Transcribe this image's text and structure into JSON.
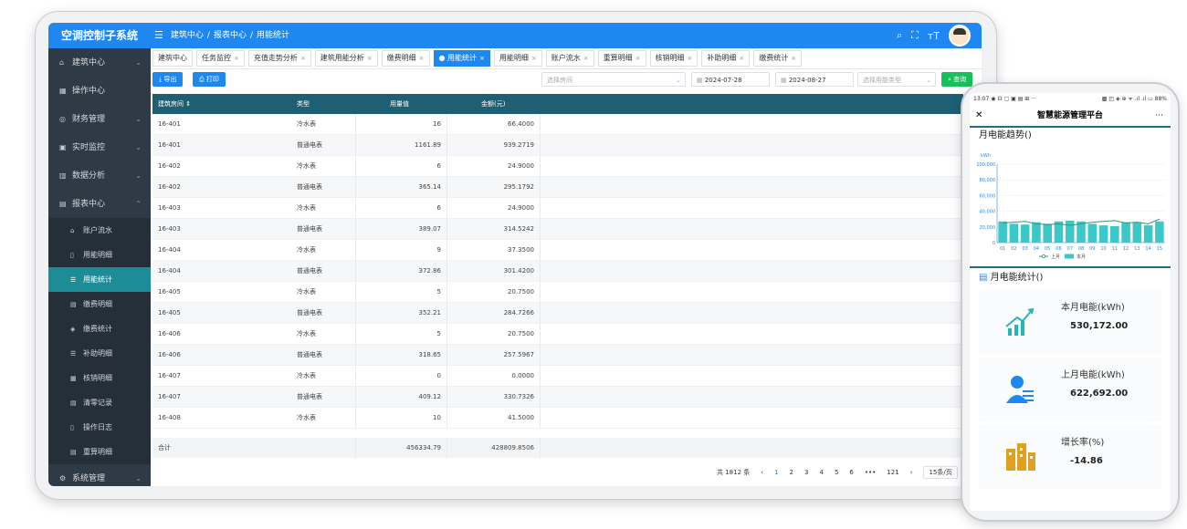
{
  "app": {
    "title": "空调控制子系统",
    "breadcrumb": [
      "建筑中心",
      "报表中心",
      "用能统计"
    ]
  },
  "sidebar": {
    "items": [
      {
        "label": "建筑中心",
        "icon": "home-icon",
        "arrow": "⌄"
      },
      {
        "label": "操作中心",
        "icon": "grid-icon",
        "arrow": ""
      },
      {
        "label": "财务管理",
        "icon": "finance-icon",
        "arrow": "⌄"
      },
      {
        "label": "实时监控",
        "icon": "monitor-icon",
        "arrow": "⌄"
      },
      {
        "label": "数据分析",
        "icon": "chart-icon",
        "arrow": "⌄"
      },
      {
        "label": "报表中心",
        "icon": "report-icon",
        "arrow": "⌃"
      }
    ],
    "sub_items": [
      "账户流水",
      "用能明细",
      "用能统计",
      "缴费明细",
      "缴费统计",
      "补助明细",
      "核销明细",
      "清零记录",
      "操作日志",
      "重算明细"
    ],
    "bottom": {
      "label": "系统管理",
      "arrow": "⌄"
    }
  },
  "tabs": [
    {
      "label": "建筑中心",
      "closable": false
    },
    {
      "label": "任务监控",
      "closable": true
    },
    {
      "label": "充值走势分析",
      "closable": true
    },
    {
      "label": "建筑用能分析",
      "closable": true
    },
    {
      "label": "缴费明细",
      "closable": true
    },
    {
      "label": "● 用能统计",
      "closable": true,
      "active": true
    },
    {
      "label": "用能明细",
      "closable": true
    },
    {
      "label": "账户流水",
      "closable": true
    },
    {
      "label": "重算明细",
      "closable": true
    },
    {
      "label": "核销明细",
      "closable": true
    },
    {
      "label": "补助明细",
      "closable": true
    },
    {
      "label": "缴费统计",
      "closable": true
    }
  ],
  "toolbar": {
    "export": "⤓ 导出",
    "print": "⎙ 打印",
    "room_placeholder": "选择房间",
    "date_start": "2024-07-28",
    "date_end": "2024-08-27",
    "type_placeholder": "选择用能类型",
    "query": "⌕ 查询"
  },
  "table": {
    "headers": [
      "建筑房间 ⇕",
      "类型",
      "用量值",
      "金额(元)"
    ],
    "rows": [
      [
        "16-401",
        "冷水表",
        "16",
        "66.4000"
      ],
      [
        "16-401",
        "普通电表",
        "1161.89",
        "939.2719"
      ],
      [
        "16-402",
        "冷水表",
        "6",
        "24.9000"
      ],
      [
        "16-402",
        "普通电表",
        "365.14",
        "295.1792"
      ],
      [
        "16-403",
        "冷水表",
        "6",
        "24.9000"
      ],
      [
        "16-403",
        "普通电表",
        "389.07",
        "314.5242"
      ],
      [
        "16-404",
        "冷水表",
        "9",
        "37.3500"
      ],
      [
        "16-404",
        "普通电表",
        "372.86",
        "301.4200"
      ],
      [
        "16-405",
        "冷水表",
        "5",
        "20.7500"
      ],
      [
        "16-405",
        "普通电表",
        "352.21",
        "284.7266"
      ],
      [
        "16-406",
        "冷水表",
        "5",
        "20.7500"
      ],
      [
        "16-406",
        "普通电表",
        "318.65",
        "257.5967"
      ],
      [
        "16-407",
        "冷水表",
        "0",
        "0.0000"
      ],
      [
        "16-407",
        "普通电表",
        "409.12",
        "330.7326"
      ],
      [
        "16-408",
        "冷水表",
        "10",
        "41.5000"
      ]
    ],
    "summary": {
      "label": "合计",
      "usage": "456334.79",
      "amount": "428809.8506"
    }
  },
  "pagination": {
    "total": "共 1812 条",
    "prev": "‹",
    "pages": [
      "1",
      "2",
      "3",
      "4",
      "5",
      "6",
      "•••",
      "121"
    ],
    "next": "›",
    "size": "15条/页"
  },
  "phone": {
    "status_left": "13:07 ◉ ☊ ▢ ▣ ▤ ⊞ ···",
    "status_right": "▩ ◰ ◈ ⊕ ᯤ .ıl .ıl ▭ 88%",
    "title": "智慧能源管理平台",
    "trend_title": "月电能趋势()",
    "stats_title": "月电能统计()",
    "stats": [
      {
        "label": "本月电能(kWh)",
        "value": "530,172.00",
        "icon": "rising-chart-icon",
        "color": "#27b5b7"
      },
      {
        "label": "上月电能(kWh)",
        "value": "622,692.00",
        "icon": "user-stats-icon",
        "color": "#1e88f0"
      },
      {
        "label": "增长率(%)",
        "value": "-14.86",
        "icon": "building-icon",
        "color": "#e0a020"
      }
    ]
  },
  "chart_data": {
    "type": "bar",
    "ylabel": "kWh",
    "ylim": [
      0,
      100000
    ],
    "yticks": [
      "100,000",
      "80,000",
      "60,000",
      "40,000",
      "20,000",
      "0"
    ],
    "categories": [
      "01",
      "02",
      "03",
      "04",
      "05",
      "06",
      "07",
      "08",
      "09",
      "10",
      "11",
      "12",
      "13",
      "14",
      "15"
    ],
    "series": [
      {
        "name": "本月",
        "type": "bar",
        "color": "#3cc7c9",
        "values": [
          27000,
          24000,
          23000,
          26000,
          24000,
          27000,
          28000,
          27000,
          24000,
          22000,
          21000,
          26000,
          26000,
          22000,
          27000
        ]
      },
      {
        "name": "上月",
        "type": "line",
        "color": "#2a9d6f",
        "values": [
          25000,
          26000,
          27000,
          24000,
          23000,
          24000,
          22000,
          24000,
          26000,
          27000,
          28000,
          25000,
          26000,
          24000,
          30000
        ]
      }
    ],
    "legend": "bottom"
  }
}
